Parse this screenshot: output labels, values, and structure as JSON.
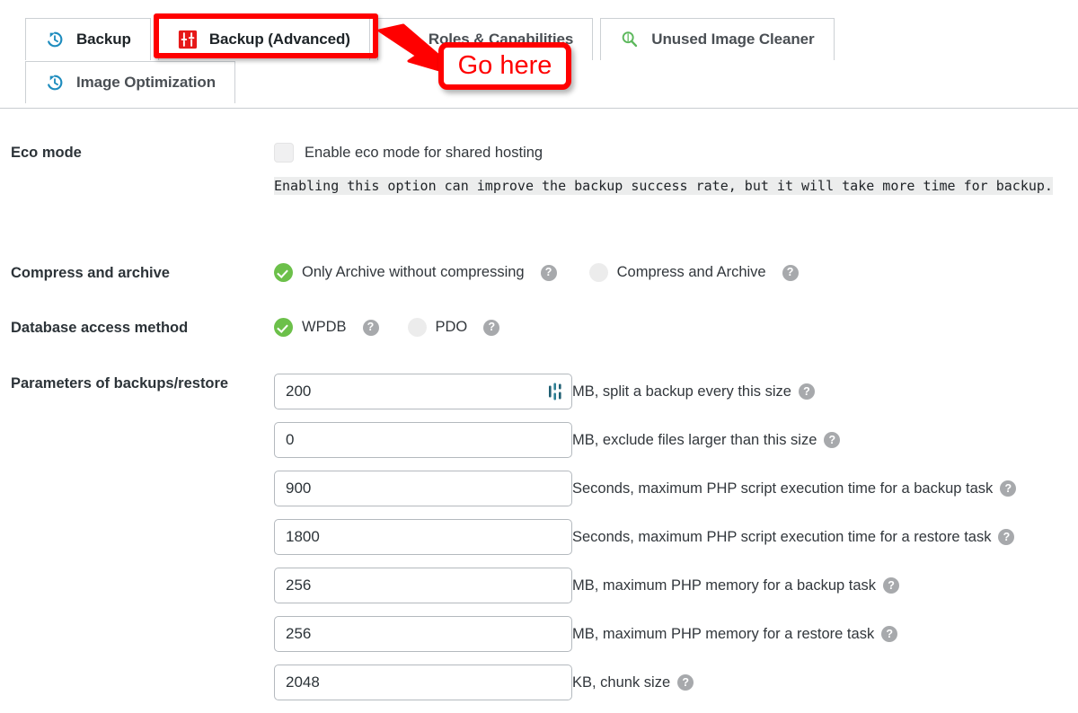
{
  "tabs": {
    "row1": [
      {
        "label": "Backup",
        "icon": "clock-history-icon",
        "active": false
      },
      {
        "label": "Backup (Advanced)",
        "icon": "sliders-icon",
        "active": true
      },
      {
        "label": "Roles & Capabilities",
        "icon": "unlock-icon",
        "active": false
      },
      {
        "label": "Unused Image Cleaner",
        "icon": "magnifier-icon",
        "active": false
      }
    ],
    "row2": [
      {
        "label": "Image Optimization",
        "icon": "clock-history-icon",
        "active": false
      }
    ]
  },
  "annotation": {
    "text": "Go here",
    "color": "#ff0000"
  },
  "form": {
    "eco": {
      "label": "Eco mode",
      "checkbox_label": "Enable eco mode for shared hosting",
      "checked": false,
      "note": "Enabling this option can improve the backup success rate, but it will take more time for backup."
    },
    "compress": {
      "label": "Compress and archive",
      "options": [
        {
          "label": "Only Archive without compressing",
          "selected": true
        },
        {
          "label": "Compress and Archive",
          "selected": false
        }
      ]
    },
    "dbmethod": {
      "label": "Database access method",
      "options": [
        {
          "label": "WPDB",
          "selected": true
        },
        {
          "label": "PDO",
          "selected": false
        }
      ]
    },
    "params": {
      "label": "Parameters of backups/restore",
      "rows": [
        {
          "value": "200",
          "suffix": "MB, split a backup every this size"
        },
        {
          "value": "0",
          "suffix": "MB, exclude files larger than this size"
        },
        {
          "value": "900",
          "suffix": "Seconds, maximum PHP script execution time for a backup task"
        },
        {
          "value": "1800",
          "suffix": "Seconds, maximum PHP script execution time for a restore task"
        },
        {
          "value": "256",
          "suffix": "MB, maximum PHP memory for a backup task"
        },
        {
          "value": "256",
          "suffix": "MB, maximum PHP memory for a restore task"
        },
        {
          "value": "2048",
          "suffix": "KB, chunk size"
        }
      ]
    },
    "help_glyph": "?"
  },
  "colors": {
    "accent_green": "#6cc04a",
    "tab_icon_blue": "#1e8cbe",
    "highlight_red": "#ff0000",
    "help_gray": "#a7a9ac"
  }
}
